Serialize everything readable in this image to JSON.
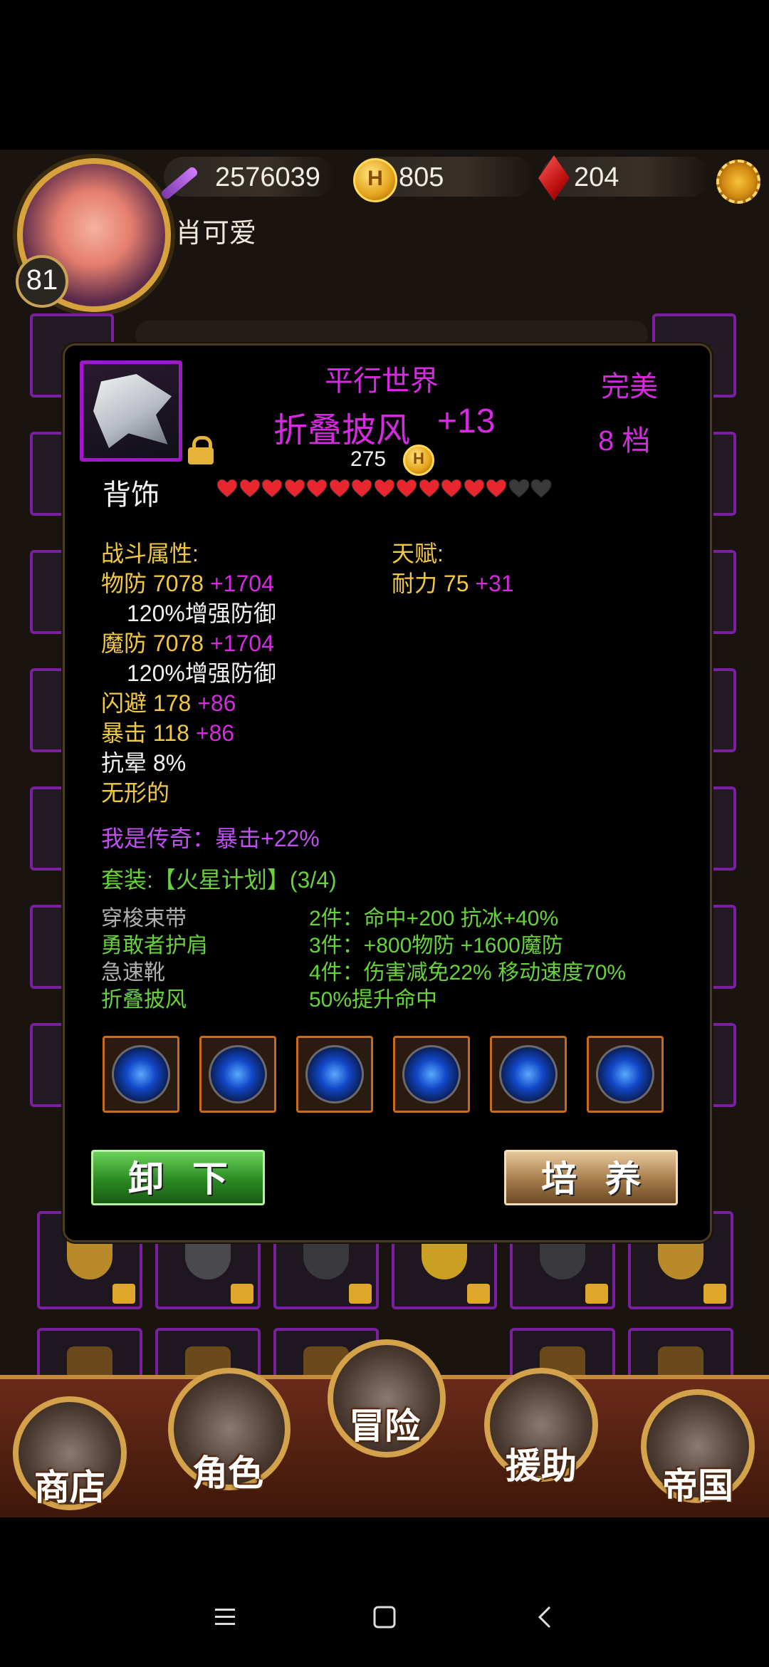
{
  "header": {
    "power": "2576039",
    "gold": "805",
    "gems": "204",
    "player_name": "肖可爱",
    "level": "81",
    "coin_glyph": "H"
  },
  "nav": {
    "shop": "商店",
    "character": "角色",
    "adventure": "冒险",
    "assist": "援助",
    "empire": "帝国"
  },
  "item": {
    "set_title": "平行世界",
    "name": "折叠披风",
    "enhance": "+13",
    "price": "275",
    "slot_type": "背饰",
    "quality": "完美",
    "tier": "8 档",
    "hearts_filled": 13,
    "hearts_total": 15
  },
  "stats": {
    "combat_header": "战斗属性:",
    "talent_header": "天赋:",
    "phys_def_label": "物防 7078",
    "phys_def_bonus": "+1704",
    "phys_def_note": "120%增强防御",
    "mag_def_label": "魔防 7078",
    "mag_def_bonus": "+1704",
    "mag_def_note": "120%增强防御",
    "dodge_label": "闪避 178",
    "dodge_bonus": "+86",
    "crit_label": "暴击 118",
    "crit_bonus": "+86",
    "stun_res": "抗晕 8%",
    "invisible": "无形的",
    "stamina_label": "耐力 75",
    "stamina_bonus": "+31",
    "legend": "我是传奇：暴击+22%"
  },
  "set": {
    "title": "套装:【火星计划】(3/4)",
    "pieces": [
      "穿梭束带",
      "勇敢者护肩",
      "急速靴",
      "折叠披风"
    ],
    "pieces_owned": [
      false,
      true,
      false,
      true
    ],
    "bonuses": [
      "2件：命中+200 抗冰+40%",
      "3件：+800物防 +1600魔防",
      "4件：伤害减免22% 移动速度70%",
      "50%提升命中"
    ]
  },
  "gems": [
    "sapphire-gem",
    "sapphire-gem",
    "sapphire-gem",
    "sapphire-gem",
    "sapphire-gem",
    "sapphire-gem"
  ],
  "buttons": {
    "unequip": "卸下",
    "train": "培养"
  },
  "colors": {
    "rarity_purple": "#d52ae0",
    "stat_gold": "#f2c842",
    "set_green": "#67d23b",
    "heart_red": "#e8262e",
    "heart_empty": "#3a3a3a"
  }
}
